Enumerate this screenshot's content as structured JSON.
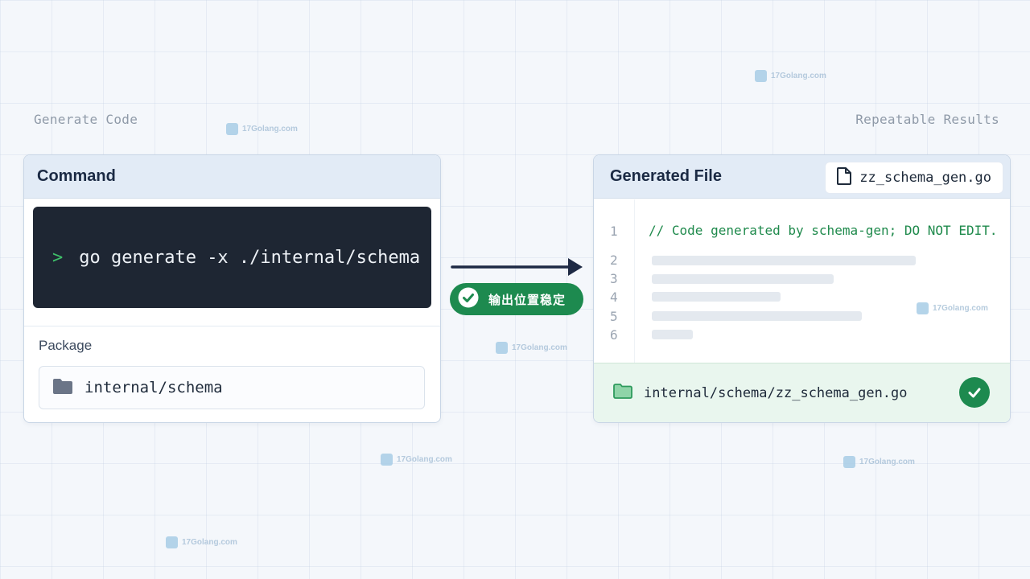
{
  "labels": {
    "left": "Generate Code",
    "right": "Repeatable Results"
  },
  "command_card": {
    "title": "Command",
    "prompt": ">",
    "command": "go generate -x ./internal/schema",
    "package_label": "Package",
    "package_value": "internal/schema"
  },
  "status": {
    "text": "输出位置稳定",
    "color": "#1d8a4f"
  },
  "generated_card": {
    "title": "Generated File",
    "filename": "zz_schema_gen.go",
    "line_numbers": [
      "1",
      "2",
      "3",
      "4",
      "5",
      "6"
    ],
    "code_line_1": "// Code generated by schema-gen; DO NOT EDIT.",
    "output_path": "internal/schema/zz_schema_gen.go"
  },
  "watermark": "17Golang.com",
  "icons": {
    "folder": "folder-icon",
    "file": "file-icon",
    "check": "check-icon",
    "arrow": "arrow-right-icon"
  },
  "colors": {
    "accent_green": "#1d8a4f",
    "terminal_bg": "#1e2633",
    "prompt_green": "#3fbf6a"
  }
}
